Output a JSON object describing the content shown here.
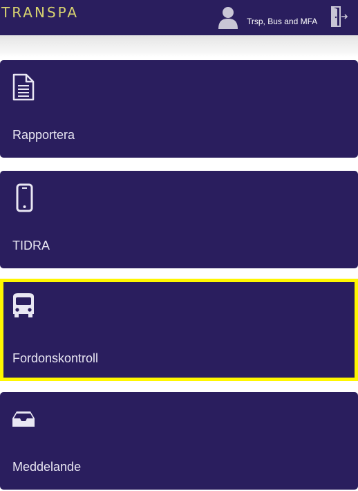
{
  "header": {
    "brand": "TRANSPA",
    "user_name": "Trsp, Bus and MFA",
    "user_icon": "user-icon",
    "logout_icon": "logout-door-icon"
  },
  "tiles": [
    {
      "label": "Rapportera",
      "icon": "document-icon"
    },
    {
      "label": "TIDRA",
      "icon": "mobile-phone-icon"
    },
    {
      "label": "Fordonskontroll",
      "icon": "bus-icon",
      "highlighted": true
    },
    {
      "label": "Meddelande",
      "icon": "inbox-icon"
    }
  ],
  "colors": {
    "tile_background": "#2a1e5e",
    "brand_text": "#d9d470",
    "highlight_border": "#fff700",
    "label_text": "#e9e7f3"
  }
}
